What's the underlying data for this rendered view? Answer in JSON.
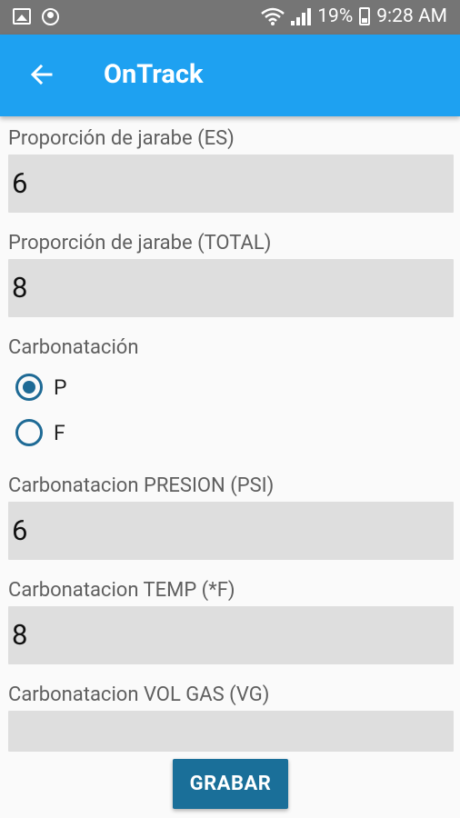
{
  "status_bar": {
    "battery": "19%",
    "time": "9:28 AM"
  },
  "app_bar": {
    "title": "OnTrack"
  },
  "form": {
    "jarabe_es": {
      "label": "Proporción de jarabe (ES)",
      "value": "6"
    },
    "jarabe_total": {
      "label": "Proporción de jarabe (TOTAL)",
      "value": "8"
    },
    "carbonatacion": {
      "label": "Carbonatación",
      "options": [
        {
          "label": "P",
          "checked": true
        },
        {
          "label": "F",
          "checked": false
        }
      ]
    },
    "presion": {
      "label": "Carbonatacion PRESION (PSI)",
      "value": "6"
    },
    "temp": {
      "label": "Carbonatacion TEMP (*F)",
      "value": "8"
    },
    "vol_gas": {
      "label": "Carbonatacion VOL GAS (VG)",
      "value": ""
    },
    "submit_label": "GRABAR"
  }
}
